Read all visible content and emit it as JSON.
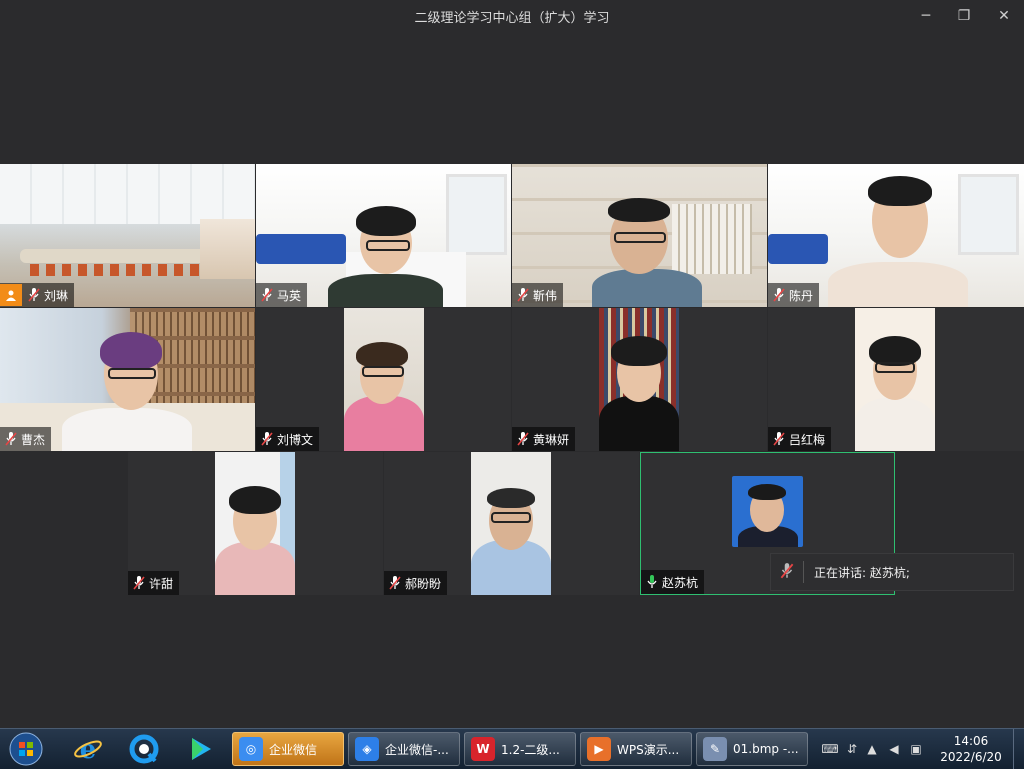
{
  "window": {
    "title": "二级理论学习中心组（扩大）学习",
    "buttons": {
      "minimize": "─",
      "maximize": "❐",
      "close": "✕"
    }
  },
  "participants": [
    {
      "name": "刘琳",
      "host": true,
      "mic": "muted"
    },
    {
      "name": "马英",
      "mic": "muted"
    },
    {
      "name": "靳伟",
      "mic": "muted"
    },
    {
      "name": "陈丹",
      "mic": "muted"
    },
    {
      "name": "曹杰",
      "mic": "muted"
    },
    {
      "name": "刘博文",
      "mic": "muted"
    },
    {
      "name": "黄琳妍",
      "mic": "muted"
    },
    {
      "name": "吕红梅",
      "mic": "muted"
    },
    {
      "name": "许甜",
      "mic": "muted"
    },
    {
      "name": "郝盼盼",
      "mic": "muted"
    },
    {
      "name": "赵苏杭",
      "mic": "active",
      "speaking": true
    }
  ],
  "speaking": {
    "label": "正在讲话: 赵苏杭;"
  },
  "colors": {
    "speaker_border": "#2fbf71",
    "mic_active": "#34c759",
    "mic_muted": "#e64545",
    "host_badge": "#f28c18"
  },
  "taskbar": {
    "buttons": [
      {
        "label": "企业微信",
        "icon": "wecom-icon",
        "active": true
      },
      {
        "label": "企业微信-...",
        "icon": "wecom-meeting-icon"
      },
      {
        "label": "1.2-二级...",
        "icon": "wps-writer-icon"
      },
      {
        "label": "WPS演示...",
        "icon": "wps-presentation-icon"
      },
      {
        "label": "01.bmp -...",
        "icon": "paint-icon"
      }
    ],
    "pinned": [
      "start-orb-icon",
      "ie-icon",
      "qq-browser-icon",
      "video-player-icon"
    ],
    "clock": {
      "time": "14:06",
      "date": "2022/6/20"
    }
  }
}
